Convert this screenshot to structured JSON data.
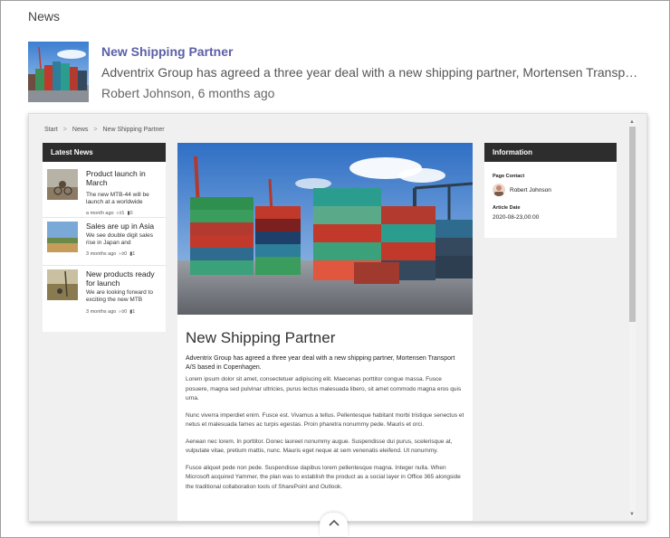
{
  "section": {
    "title": "News"
  },
  "feed_item": {
    "title": "New Shipping Partner",
    "summary": "Adventrix Group has agreed a three year deal with a new shipping partner, Mortensen Transport A/S based in Copenhagen.",
    "meta": "Robert Johnson, 6 months ago"
  },
  "preview": {
    "breadcrumb": [
      "Start",
      "News",
      "New Shipping Partner"
    ],
    "breadcrumb_separator": ">",
    "latest_news": {
      "heading": "Latest News",
      "items": [
        {
          "title": "Product launch in March",
          "text": "The new MTB-44 will be launch at a worldwide",
          "date": "a month ago",
          "likes": "1",
          "comments": "0"
        },
        {
          "title": "Sales are up in Asia",
          "text": "We see double digit sales rise in Japan and",
          "date": "3 months ago",
          "likes": "0",
          "comments": "1"
        },
        {
          "title": "New products ready for launch",
          "text": "We are looking forward to exciting the new MTB",
          "date": "3 months ago",
          "likes": "0",
          "comments": "1"
        }
      ]
    },
    "article": {
      "title": "New Shipping Partner",
      "lead": "Adventrix Group has agreed a three year deal with a new shipping partner, Mortensen Transport A/S based in Copenhagen.",
      "paragraphs": [
        "Lorem ipsum dolor sit amet, consectetuer adipiscing elit. Maecenas porttitor congue massa. Fusce posuere, magna sed pulvinar ultricies, purus lectus malesuada libero, sit amet commodo magna eros quis urna.",
        "Nunc viverra imperdiet enim. Fusce est. Vivamus a tellus. Pellentesque habitant morbi tristique senectus et netus et malesuada fames ac turpis egestas. Proin pharetra nonummy pede. Mauris et orci.",
        "Aenean nec lorem. In porttitor. Donec laoreet nonummy augue. Suspendisse dui purus, scelerisque at, vulputate vitae, pretium mattis, nunc. Mauris eget neque at sem venenatis eleifend. Ut nonummy.",
        "Fusce aliquet pede non pede. Suspendisse dapibus lorem pellentesque magna. Integer nulla. When Microsoft acquired Yammer, the plan was to establish the product as a social layer in Office 365 alongside the traditional collaboration tools of SharePoint and Outlook."
      ]
    },
    "information": {
      "heading": "Information",
      "contact_label": "Page Contact",
      "contact_name": "Robert Johnson",
      "date_label": "Article Date",
      "date_value": "2020-08-23,00:00"
    }
  },
  "icons": {
    "like": "thumbs-up-icon",
    "comment": "comment-icon",
    "collapse": "chevron-up-icon"
  },
  "colors": {
    "link": "#5c5fa6",
    "panel_header": "#2d2d2d",
    "preview_background": "#f0f0f0"
  }
}
